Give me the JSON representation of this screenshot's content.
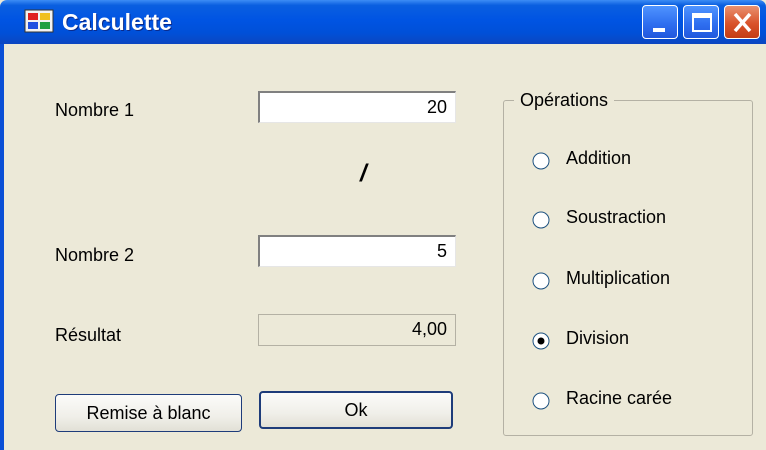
{
  "window": {
    "title": "Calculette"
  },
  "titlebar_buttons": [
    "minimize-button",
    "maximize-button",
    "close-button"
  ],
  "form": {
    "nombre1_label": "Nombre 1",
    "nombre1_value": "20",
    "operator_symbol": "/",
    "nombre2_label": "Nombre 2",
    "nombre2_value": "5",
    "resultat_label": "Résultat",
    "resultat_value": "4,00",
    "reset_button_label": "Remise à blanc",
    "ok_button_label": "Ok"
  },
  "operations": {
    "legend": "Opérations",
    "options": [
      {
        "label": "Addition",
        "selected": false
      },
      {
        "label": "Soustraction",
        "selected": false
      },
      {
        "label": "Multiplication",
        "selected": false
      },
      {
        "label": "Division",
        "selected": true
      },
      {
        "label": "Racine carée",
        "selected": false
      }
    ]
  },
  "colors": {
    "titlebar": "#0054e3",
    "window_background": "#ece9d8",
    "close_button": "#d9532b"
  },
  "icons": {
    "app": "app-window-icon",
    "minimize": "minimize-icon",
    "maximize": "maximize-icon",
    "close": "close-icon"
  }
}
